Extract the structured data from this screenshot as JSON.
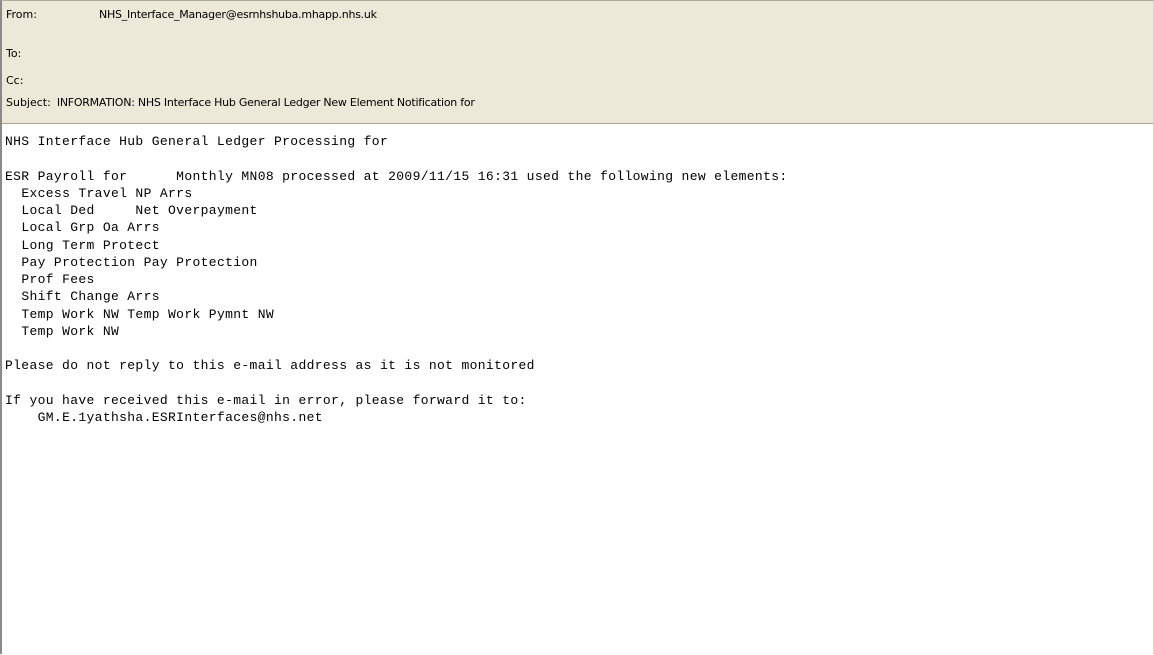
{
  "email": {
    "from_label": "From:",
    "from_value": "NHS_Interface_Manager@esrnhshuba.mhapp.nhs.uk",
    "to_label": "To:",
    "to_value": "",
    "cc_label": "Cc:",
    "cc_value": "",
    "subject_label": "Subject:",
    "subject_value": "INFORMATION: NHS Interface Hub General Ledger New Element Notification for"
  },
  "body": {
    "heading": "NHS Interface Hub General Ledger Processing for",
    "payroll_line": "ESR Payroll for      Monthly MN08 processed at 2009/11/15 16:31 used the following new elements:",
    "elements": [
      "Excess Travel NP Arrs",
      "Local Ded     Net Overpayment",
      "Local Grp Oa Arrs",
      "Long Term Protect",
      "Pay Protection Pay Protection",
      "Prof Fees",
      "Shift Change Arrs",
      "Temp Work NW Temp Work Pymnt NW",
      "Temp Work NW"
    ],
    "no_reply_notice": "Please do not reply to this e-mail address as it is not monitored",
    "error_notice": "If you have received this e-mail in error, please forward it to:",
    "forward_address": "GM.E.1yathsha.ESRInterfaces@nhs.net"
  },
  "colors": {
    "header_background": "#ece9d8",
    "body_background": "#ffffff",
    "text": "#000000"
  }
}
